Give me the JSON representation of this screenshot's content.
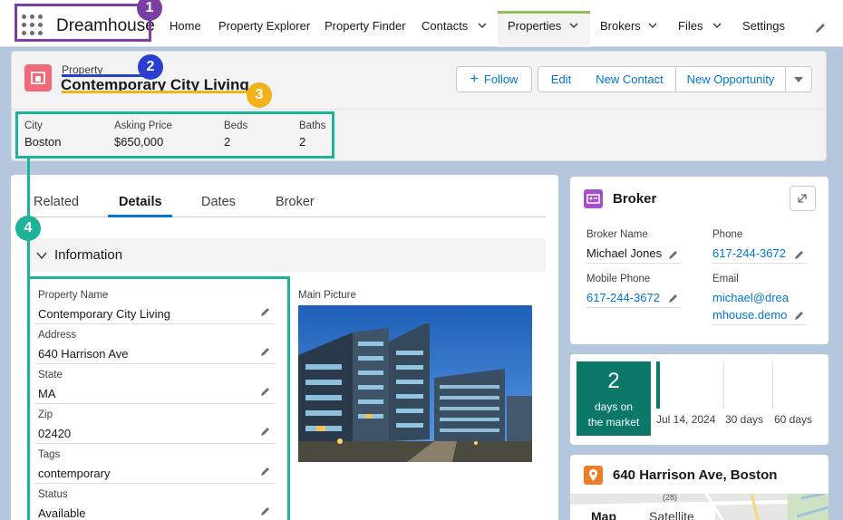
{
  "app": {
    "name": "Dreamhouse",
    "nav_items": [
      {
        "label": "Home"
      },
      {
        "label": "Property Explorer"
      },
      {
        "label": "Property Finder"
      },
      {
        "label": "Contacts"
      },
      {
        "label": "Properties"
      },
      {
        "label": "Brokers"
      },
      {
        "label": "Files"
      },
      {
        "label": "Settings"
      }
    ],
    "active_nav": "Properties"
  },
  "annotations": {
    "badge1": "1",
    "badge2": "2",
    "badge3": "3",
    "badge4": "4"
  },
  "record": {
    "object_type": "Property",
    "title": "Contemporary City Living",
    "actions": {
      "follow": "Follow",
      "edit": "Edit",
      "new_contact": "New Contact",
      "new_opportunity": "New Opportunity"
    },
    "highlights": [
      {
        "label": "City",
        "value": "Boston"
      },
      {
        "label": "Asking Price",
        "value": "$650,000"
      },
      {
        "label": "Beds",
        "value": "2"
      },
      {
        "label": "Baths",
        "value": "2"
      }
    ]
  },
  "tabs": [
    {
      "label": "Related"
    },
    {
      "label": "Details"
    },
    {
      "label": "Dates"
    },
    {
      "label": "Broker"
    }
  ],
  "active_tab": "Details",
  "details": {
    "section_title": "Information",
    "fields": [
      {
        "label": "Property Name",
        "value": "Contemporary City Living"
      },
      {
        "label": "Address",
        "value": "640 Harrison Ave"
      },
      {
        "label": "State",
        "value": "MA"
      },
      {
        "label": "Zip",
        "value": "02420"
      },
      {
        "label": "Tags",
        "value": "contemporary"
      },
      {
        "label": "Status",
        "value": "Available"
      }
    ],
    "picture_label": "Main Picture"
  },
  "broker": {
    "title": "Broker",
    "name_label": "Broker Name",
    "name": "Michael Jones",
    "phone_label": "Phone",
    "phone": "617-244-3672",
    "mobile_label": "Mobile Phone",
    "mobile": "617-244-3672",
    "email_label": "Email",
    "email_line1": "michael@drea",
    "email_line2": "mhouse.demo"
  },
  "days_on_market": {
    "count": "2",
    "line1": "days on",
    "line2": "the market",
    "labels": [
      "Jul 14, 2024",
      "30 days",
      "60 days"
    ]
  },
  "map": {
    "title": "640 Harrison Ave, Boston",
    "tab_map": "Map",
    "tab_satellite": "Satellite",
    "road_label": "(28)"
  },
  "colors": {
    "brand_blue": "#0176d3",
    "property_icon": "#f26979",
    "broker_icon": "#a450c9",
    "map_icon": "#ef7c28",
    "days_box": "#0b7868",
    "annotation_purple": "#7b3ea3",
    "annotation_blue": "#2a3fd0",
    "annotation_yellow": "#f2b21a",
    "annotation_teal": "#1fb29b"
  }
}
